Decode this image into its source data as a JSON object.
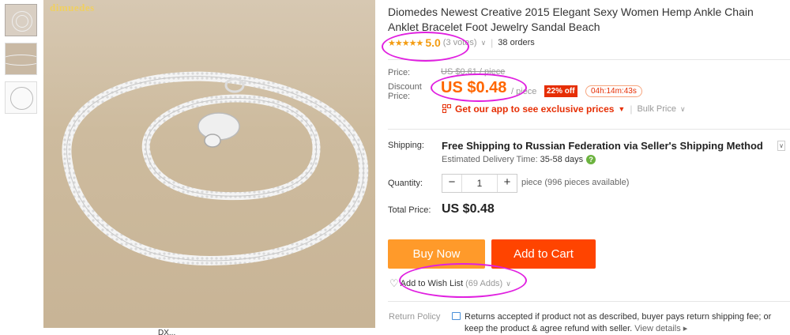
{
  "image": {
    "brand_watermark": "dimuedes",
    "caption_below": "DX..."
  },
  "product": {
    "title": "Diomedes Newest Creative 2015 Elegant Sexy Women Hemp Ankle Chain Anklet Bracelet Foot Jewelry Sandal Beach"
  },
  "rating": {
    "stars": "★★★★★",
    "value": "5.0",
    "votes": "(3 votes)",
    "orders": "38 orders"
  },
  "price": {
    "label": "Price:",
    "original": "US $0.61 / piece",
    "discount_label": "Discount Price:",
    "discount_value": "US $0.48",
    "per_unit": "/ piece",
    "off_badge": "22% off",
    "countdown": "04h:14m:43s"
  },
  "app_promo": {
    "text": "Get our app to see exclusive prices",
    "bulk_label": "Bulk Price"
  },
  "shipping": {
    "label": "Shipping:",
    "method": "Free Shipping to Russian Federation via Seller's Shipping Method",
    "delivery_label": "Estimated Delivery Time:",
    "delivery_value": "35-58 days"
  },
  "quantity": {
    "label": "Quantity:",
    "value": "1",
    "minus": "−",
    "plus": "+",
    "note": "piece (996 pieces available)"
  },
  "total": {
    "label": "Total Price:",
    "value": "US $0.48"
  },
  "actions": {
    "buy_now": "Buy Now",
    "add_to_cart": "Add to Cart",
    "wishlist": "Add to Wish List",
    "wishlist_count": "(69 Adds)"
  },
  "return_policy": {
    "label": "Return Policy",
    "text": "Returns accepted if product not as described, buyer pays return shipping fee; or keep the product & agree refund with seller.",
    "link": "View details ▸"
  },
  "colors": {
    "accent_orange": "#ff6600",
    "buy_now_bg": "#ff9a2a",
    "add_to_cart_bg": "#ff4400",
    "annotation_magenta": "#e020e0"
  }
}
